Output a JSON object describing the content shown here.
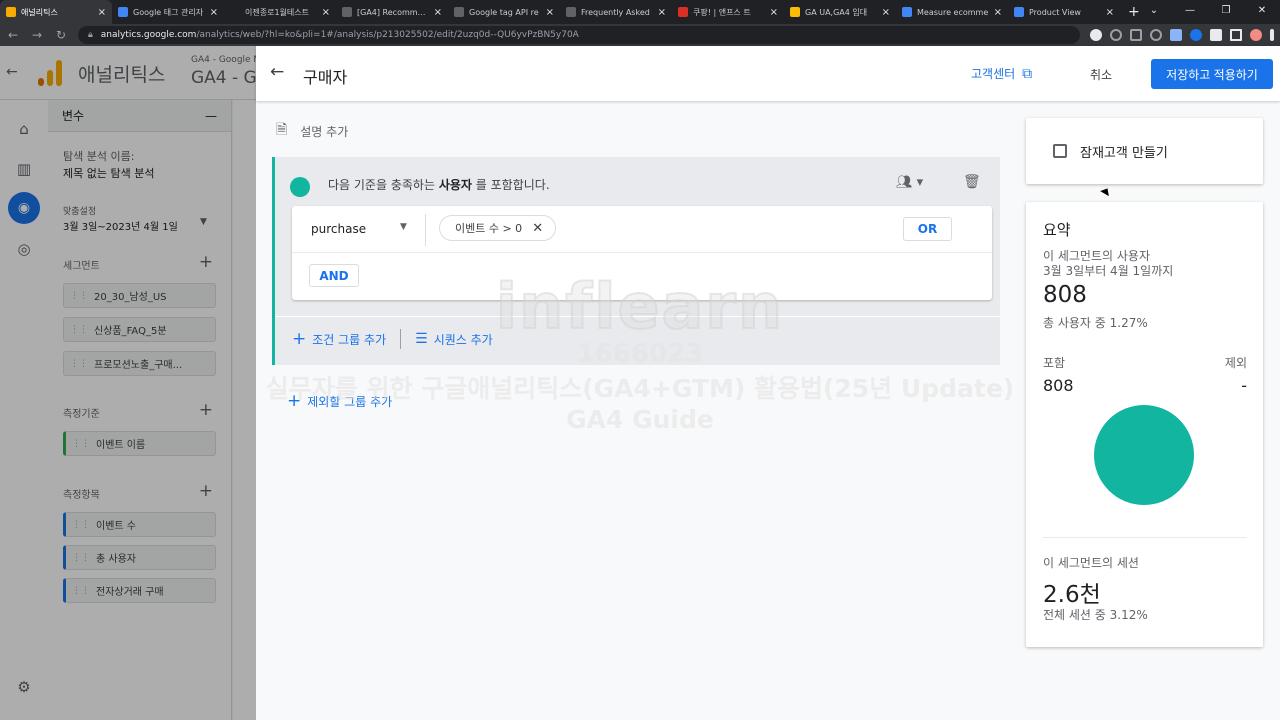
{
  "browser": {
    "tabs": [
      {
        "title": "애널리틱스",
        "color": "#f9ab00",
        "active": true
      },
      {
        "title": "Google 태그 관리자",
        "color": "#4285f4",
        "active": false
      },
      {
        "title": "이젠종로1월테스트",
        "color": "#202124",
        "active": false
      },
      {
        "title": "[GA4] Recommend",
        "color": "#5f6368",
        "active": false
      },
      {
        "title": "Google tag API re",
        "color": "#5f6368",
        "active": false
      },
      {
        "title": "Frequently Asked",
        "color": "#5f6368",
        "active": false
      },
      {
        "title": "쿠팡! | 앤프스 트",
        "color": "#d93025",
        "active": false
      },
      {
        "title": "GA UA,GA4 임대",
        "color": "#fbbc04",
        "active": false
      },
      {
        "title": "Measure ecomme",
        "color": "#4285f4",
        "active": false
      },
      {
        "title": "Product View",
        "color": "#4285f4",
        "active": false
      }
    ],
    "new_tab_label": "+",
    "url_host": "analytics.google.com",
    "url_path": "/analytics/web/?hl=ko&pli=1#/analysis/p213025502/edit/2uzq0d--QU6yvPzBN5y70A"
  },
  "app": {
    "title": "애널리틱스",
    "property_small": "GA4 - Google M",
    "property": "GA4 - G",
    "variables_header": "변수",
    "exploration_name_label": "탐색 분석 이름:",
    "exploration_name": "제목 없는 탐색 분석",
    "date_label": "맞춤설정",
    "date_range": "3월 3일~2023년 4월 1일",
    "segments_label": "세그먼트",
    "segments": [
      "20_30_남성_US",
      "신상품_FAQ_5분",
      "프로모션노출_구매..."
    ],
    "dimensions_label": "측정기준",
    "dimensions": [
      "이벤트 이름"
    ],
    "metrics_label": "측정항목",
    "metrics": [
      "이벤트 수",
      "총 사용자",
      "전자상거래 구매"
    ]
  },
  "editor": {
    "title": "구매자",
    "help_center": "고객센터",
    "cancel": "취소",
    "save": "저장하고 적용하기",
    "description_placeholder": "설명 추가",
    "sentence_prefix": "다음 기준을 충족하는",
    "sentence_bold": "사용자",
    "sentence_suffix": "를 포함합니다.",
    "condition_event": "purchase",
    "condition_filter": "이벤트 수 > 0",
    "or_label": "OR",
    "and_label": "AND",
    "add_condition_group": "조건 그룹 추가",
    "add_sequence": "시퀀스 추가",
    "add_exclude_group": "제외할 그룹 추가",
    "accent_color": "#12b5a0"
  },
  "side": {
    "audience_checkbox": "잠재고객 만들기",
    "audience_checked": false
  },
  "summary": {
    "title": "요약",
    "users_label": "이 세그먼트의 사용자",
    "date_label": "3월 3일부터 4월 1일까지",
    "users": "808",
    "users_pct": "총 사용자 중 1.27%",
    "include_label": "포함",
    "exclude_label": "제외",
    "include_value": "808",
    "exclude_value": "-",
    "sessions_label": "이 세그먼트의 세션",
    "sessions": "2.6천",
    "sessions_pct": "전체 세션 중 3.12%",
    "pie_color": "#12b5a0"
  },
  "watermark": {
    "brand": "inflearn",
    "id": "1666023",
    "line2": "실무자를 위한 구글애널리틱스(GA4+GTM) 활용법(25년 Update)",
    "line3": "GA4 Guide"
  }
}
